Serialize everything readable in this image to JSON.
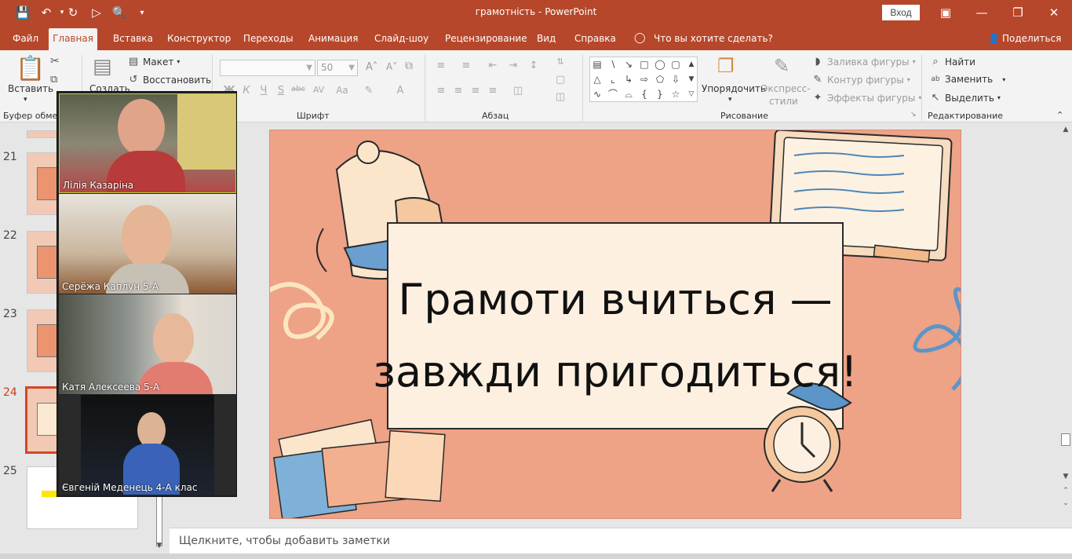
{
  "app": {
    "document_name": "грамотність",
    "app_name": "PowerPoint",
    "separator": "-",
    "login_label": "Вход",
    "accent": "#b7472a"
  },
  "tabs": [
    {
      "label": "Файл"
    },
    {
      "label": "Главная",
      "active": true
    },
    {
      "label": "Вставка"
    },
    {
      "label": "Конструктор"
    },
    {
      "label": "Переходы"
    },
    {
      "label": "Анимация"
    },
    {
      "label": "Слайд-шоу"
    },
    {
      "label": "Рецензирование"
    },
    {
      "label": "Вид"
    },
    {
      "label": "Справка"
    },
    {
      "label": "Что вы хотите сделать?"
    },
    {
      "label": "Поделиться"
    }
  ],
  "ribbon": {
    "clipboard": {
      "paste": "Вставить",
      "group": "Буфер обмен"
    },
    "slides": {
      "create": "Создать",
      "layout": "Макет",
      "reset": "Восстановить"
    },
    "font": {
      "font_name": "",
      "font_size": "50",
      "group": "Шрифт"
    },
    "paragraph": {
      "group": "Абзац"
    },
    "drawing": {
      "arrange": "Упорядочить",
      "styles_line1": "Экспресс-",
      "styles_line2": "стили",
      "fill": "Заливка фигуры",
      "outline": "Контур фигуры",
      "effects": "Эффекты фигуры",
      "group": "Рисование"
    },
    "editing": {
      "find": "Найти",
      "replace": "Заменить",
      "select": "Выделить",
      "group": "Редактирование"
    }
  },
  "thumbnails": [
    {
      "number": "21"
    },
    {
      "number": "22"
    },
    {
      "number": "23"
    },
    {
      "number": "24",
      "current": true
    },
    {
      "number": "25"
    }
  ],
  "participants": [
    {
      "name": "Лілія Казаріна",
      "active": true
    },
    {
      "name": "Серёжа Каплун 5-А"
    },
    {
      "name": "Катя Алексеева 5-А"
    },
    {
      "name": "Євгеній Меденець 4-А клас"
    }
  ],
  "slide": {
    "title_line1": "Грамоти вчиться —",
    "title_line2": "завжди пригодиться!",
    "background": "#eea286"
  },
  "notes": {
    "placeholder": "Щелкните, чтобы добавить заметки"
  }
}
